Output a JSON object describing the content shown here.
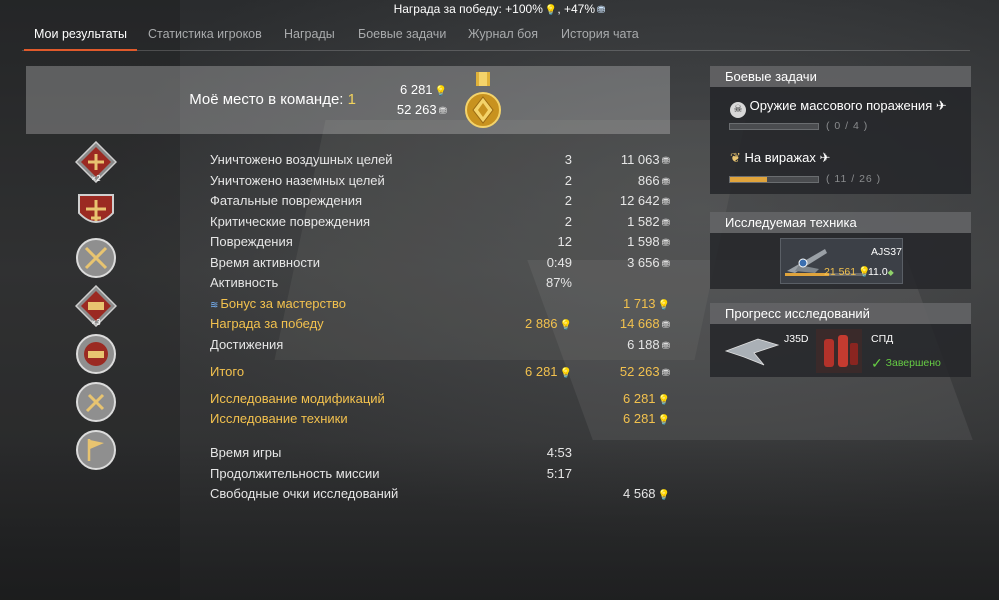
{
  "top_reward": {
    "label": "Награда за победу:",
    "rp_bonus": "+100%",
    "sl_bonus": "+47%"
  },
  "tabs": [
    {
      "label": "Мои результаты",
      "active": true
    },
    {
      "label": "Статистика игроков",
      "active": false
    },
    {
      "label": "Награды",
      "active": false
    },
    {
      "label": "Боевые задачи",
      "active": false
    },
    {
      "label": "Журнал боя",
      "active": false
    },
    {
      "label": "История чата",
      "active": false
    }
  ],
  "header": {
    "place_label": "Моё место в команде:",
    "place_value": "1",
    "rp_total": "6 281",
    "sl_total": "52 263"
  },
  "stats": [
    {
      "label": "Уничтожено воздушных целей",
      "count": "3",
      "reward": "11 063",
      "icon": "silver-lions-icon"
    },
    {
      "label": "Уничтожено наземных целей",
      "count": "2",
      "reward": "866",
      "icon": "silver-lions-icon"
    },
    {
      "label": "Фатальные повреждения",
      "count": "2",
      "reward": "12 642",
      "icon": "silver-lions-icon"
    },
    {
      "label": "Критические повреждения",
      "count": "2",
      "reward": "1 582",
      "icon": "silver-lions-icon"
    },
    {
      "label": "Повреждения",
      "count": "12",
      "reward": "1 598",
      "icon": "silver-lions-icon"
    },
    {
      "label": "Время активности",
      "count": "0:49",
      "reward": "3 656",
      "icon": "silver-lions-icon"
    },
    {
      "label": "Активность",
      "count": "87%",
      "reward": "",
      "icon": ""
    },
    {
      "label": "Бонус за мастерство",
      "count": "",
      "reward": "1 713",
      "icon": "research-points-icon"
    },
    {
      "label": "Награда за победу",
      "count": "2 886",
      "reward": "14 668",
      "icon": "silver-lions-icon"
    },
    {
      "label": "Достижения",
      "count": "",
      "reward": "6 188",
      "icon": "silver-lions-icon"
    },
    {
      "label": "Итого",
      "count": "6 281",
      "reward": "52 263",
      "icon": "silver-lions-icon"
    },
    {
      "label": "Исследование модификаций",
      "count": "",
      "reward": "6 281",
      "icon": "research-points-icon"
    },
    {
      "label": "Исследование техники",
      "count": "",
      "reward": "6 281",
      "icon": "research-points-icon"
    },
    {
      "label": "Время игры",
      "count": "4:53",
      "reward": "",
      "icon": ""
    },
    {
      "label": "Продолжительность миссии",
      "count": "5:17",
      "reward": "",
      "icon": ""
    },
    {
      "label": "Свободные очки исследований",
      "count": "",
      "reward": "4 568",
      "icon": "free-research-points-icon"
    }
  ],
  "badges": [
    {
      "name": "badge-air-kills-x2",
      "mult": "×2"
    },
    {
      "name": "badge-fighter",
      "mult": ""
    },
    {
      "name": "badge-crossed-swords",
      "mult": ""
    },
    {
      "name": "badge-ground-kills-x3",
      "mult": "×3"
    },
    {
      "name": "badge-tank",
      "mult": ""
    },
    {
      "name": "badge-wrench",
      "mult": ""
    },
    {
      "name": "badge-flag",
      "mult": ""
    }
  ],
  "combat_tasks": {
    "title": "Боевые задачи",
    "items": [
      {
        "label": "Оружие массового поражения",
        "progress_text": "( 0 / 4 )",
        "progress": 0.0
      },
      {
        "label": "На виражах",
        "progress_text": "( 11 / 26 )",
        "progress": 0.4231
      }
    ]
  },
  "researched_vehicle": {
    "title": "Исследуемая техника",
    "name": "AJS37",
    "rp": "21 561",
    "br": "11.0"
  },
  "research_progress": {
    "title": "Прогресс исследований",
    "items": [
      {
        "name": "J35D"
      },
      {
        "name": "СПД",
        "status": "Завершено"
      }
    ]
  },
  "colors": {
    "accent_tab": "#e05a2b",
    "gold_text": "#f2c14e",
    "place_value": "#f2d35c",
    "status_done": "#66cc44",
    "progress_fill": "#e0a43c"
  }
}
